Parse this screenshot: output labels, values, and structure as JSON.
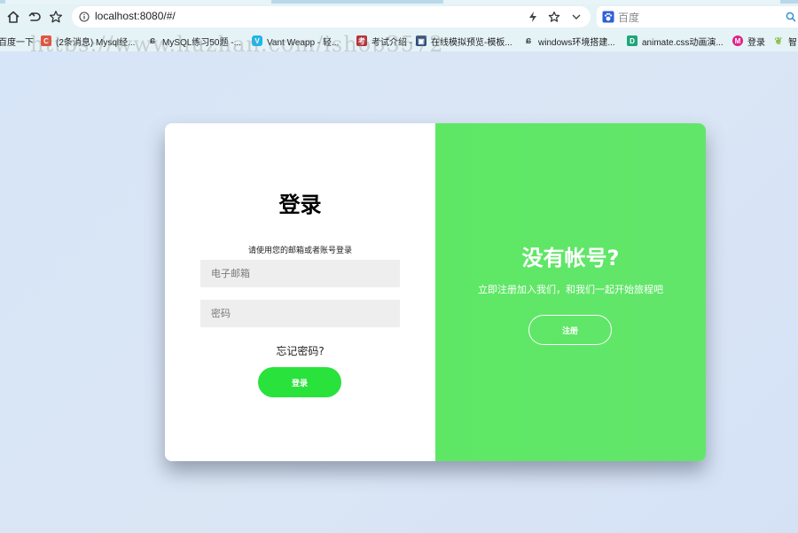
{
  "browser": {
    "url": "localhost:8080/#/",
    "search_placeholder": "百度",
    "watermark": "https://www.huzhan.com/ishop3572",
    "bookmarks": [
      {
        "label": "百度一下",
        "icon": "none",
        "color": ""
      },
      {
        "label": "(2条消息) Mysql经...",
        "icon": "csdn-icon",
        "color": "#e5533d"
      },
      {
        "label": "MySQL练习50题 -...",
        "icon": "script-icon",
        "color": "#555555"
      },
      {
        "label": "Vant Weapp - 轻...",
        "icon": "vant-icon",
        "color": "#1fb6e8"
      },
      {
        "label": "考试介绍 - ...",
        "icon": "exam-icon",
        "color": "#b8303b"
      },
      {
        "label": "在线模拟预览-模板...",
        "icon": "preview-icon",
        "color": "#2b4c7e"
      },
      {
        "label": "windows环境搭建...",
        "icon": "script-icon",
        "color": "#555555"
      },
      {
        "label": "animate.css动画演...",
        "icon": "d-icon",
        "color": "#1fa67a"
      },
      {
        "label": "登录",
        "icon": "login-icon",
        "color": "#e0218a"
      },
      {
        "label": "智",
        "icon": "leaf-icon",
        "color": "#8bbf4a"
      }
    ]
  },
  "login": {
    "title": "登录",
    "hint": "请使用您的邮箱或者账号登录",
    "email_placeholder": "电子邮箱",
    "password_placeholder": "密码",
    "forgot": "忘记密码?",
    "submit": "登录"
  },
  "signup": {
    "title": "没有帐号?",
    "subtitle": "立即注册加入我们，和我们一起开始旅程吧",
    "button": "注册"
  },
  "colors": {
    "accent": "#29e23c",
    "panel_green": "#5ee765",
    "input_bg": "#eeeeee"
  }
}
